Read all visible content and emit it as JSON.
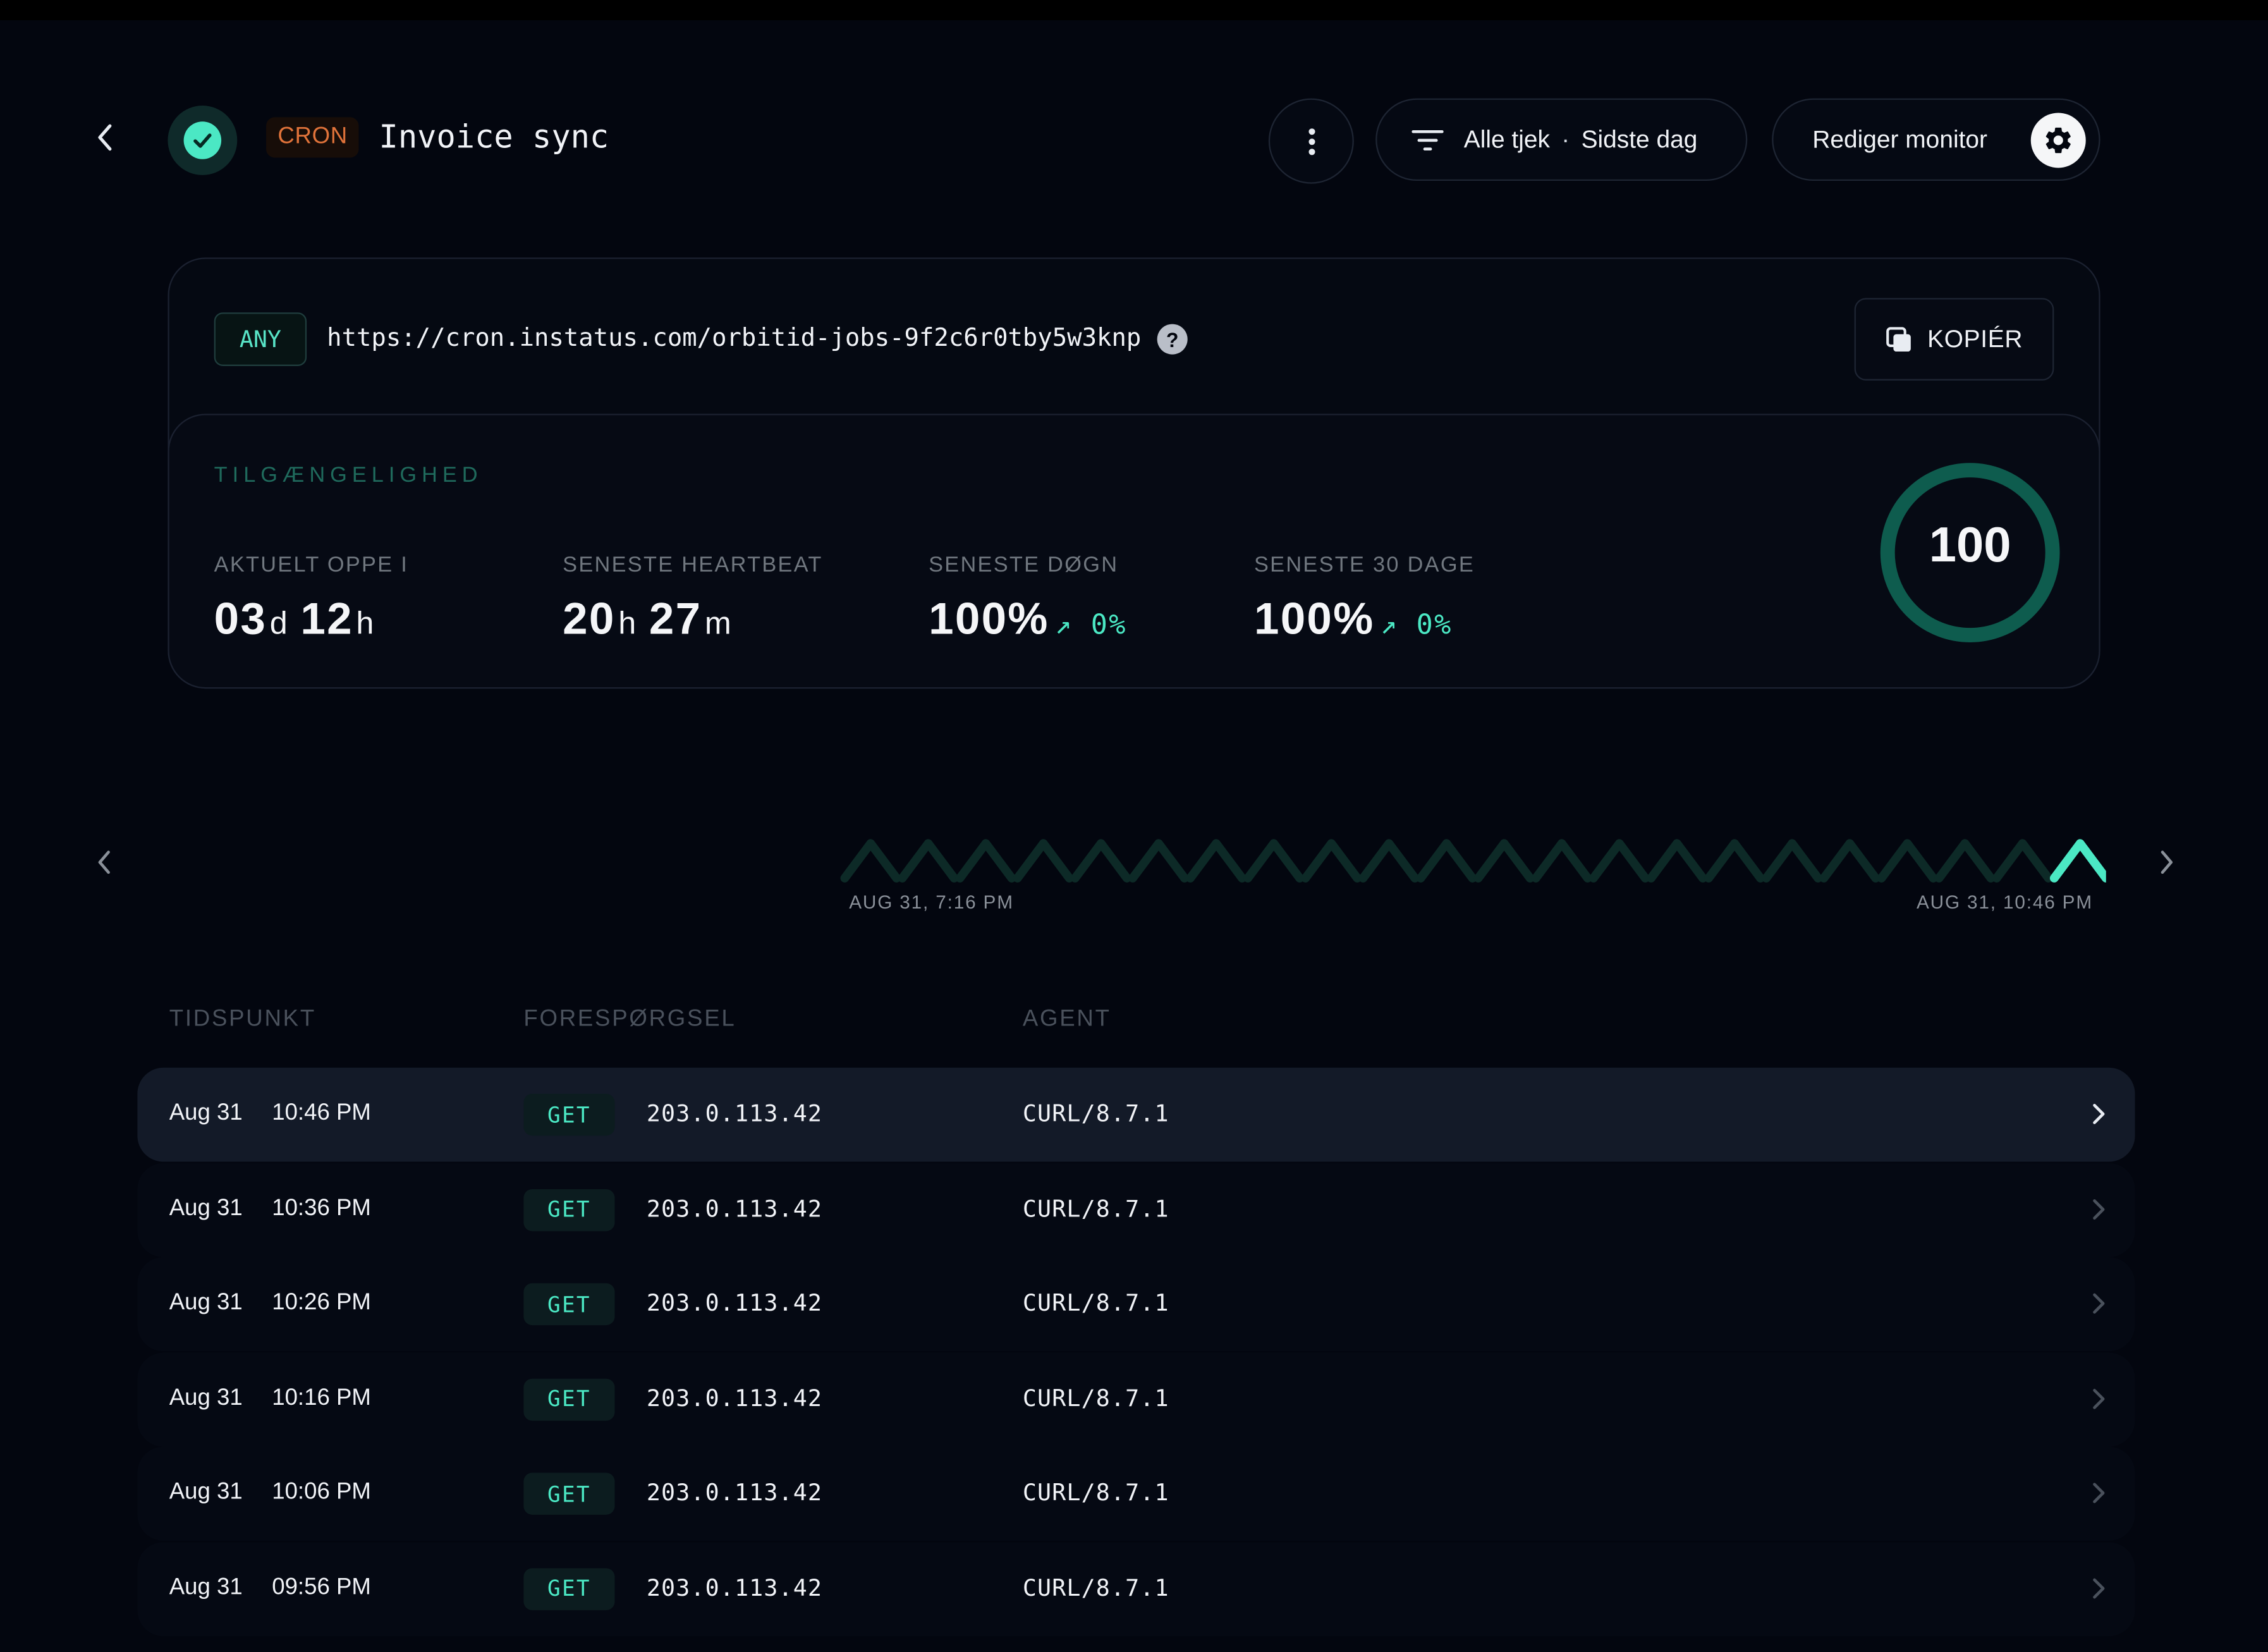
{
  "header": {
    "badge": "CRON",
    "title": "Invoice sync",
    "filter": {
      "checks": "Alle tjek",
      "separator": "·",
      "period": "Sidste dag"
    },
    "edit_label": "Rediger monitor"
  },
  "endpoint": {
    "method_badge": "ANY",
    "url": "https://cron.instatus.com/orbitid-jobs-9f2c6r0tby5w3knp",
    "help": "?",
    "copy_label": "KOPIÉR"
  },
  "availability": {
    "section_label": "TILGÆNGELIGHED",
    "stats": [
      {
        "label": "AKTUELT OPPE I",
        "parts": [
          [
            "03",
            "d"
          ],
          [
            "12",
            "h"
          ]
        ]
      },
      {
        "label": "SENESTE HEARTBEAT",
        "parts": [
          [
            "20",
            "h"
          ],
          [
            "27",
            "m"
          ]
        ]
      },
      {
        "label": "SENESTE DØGN",
        "value": "100%",
        "trend": "↗ 0%"
      },
      {
        "label": "SENESTE 30 DAGE",
        "value": "100%",
        "trend": "↗ 0%"
      }
    ],
    "score": "100"
  },
  "timeline": {
    "start_label": "AUG 31, 7:16 PM",
    "end_label": "AUG 31, 10:46 PM",
    "beats": 22,
    "active_beats": 1
  },
  "table": {
    "headers": {
      "time": "TIDSPUNKT",
      "request": "FORESPØRGSEL",
      "agent": "AGENT"
    },
    "rows": [
      {
        "date": "Aug 31",
        "time": "10:46 PM",
        "method": "GET",
        "ip": "203.0.113.42",
        "agent": "CURL/8.7.1"
      },
      {
        "date": "Aug 31",
        "time": "10:36 PM",
        "method": "GET",
        "ip": "203.0.113.42",
        "agent": "CURL/8.7.1"
      },
      {
        "date": "Aug 31",
        "time": "10:26 PM",
        "method": "GET",
        "ip": "203.0.113.42",
        "agent": "CURL/8.7.1"
      },
      {
        "date": "Aug 31",
        "time": "10:16 PM",
        "method": "GET",
        "ip": "203.0.113.42",
        "agent": "CURL/8.7.1"
      },
      {
        "date": "Aug 31",
        "time": "10:06 PM",
        "method": "GET",
        "ip": "203.0.113.42",
        "agent": "CURL/8.7.1"
      },
      {
        "date": "Aug 31",
        "time": "09:56 PM",
        "method": "GET",
        "ip": "203.0.113.42",
        "agent": "CURL/8.7.1"
      }
    ]
  },
  "colors": {
    "accent": "#4be8c4",
    "cron": "#e0733a",
    "gauge": "#0e5c4e"
  }
}
